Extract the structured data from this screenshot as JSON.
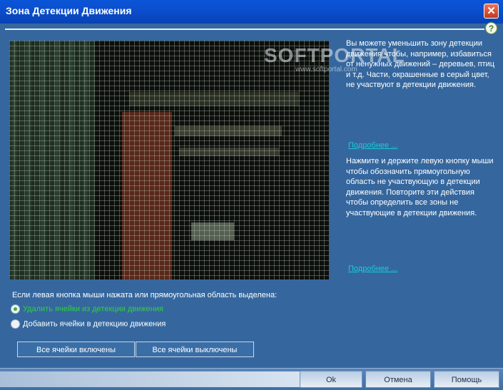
{
  "window": {
    "title": "Зона Детекции Движения",
    "close_glyph": "✕",
    "help_glyph": "?"
  },
  "watermark": {
    "brand": "SOFTPORTAL",
    "url": "www.softportal.com"
  },
  "info": {
    "paragraph1": "Вы можете уменьшить зону детекции движения чтобы, например, избавиться от ненужных движений – деревьев, птиц и т.д. Части, окрашенные в серый цвет, не участвуют в детекции движения.",
    "link1": "Подробнее ...",
    "paragraph2": "Нажмите и держите левую кнопку мыши чтобы обозначить прямоугольную область не участвующую в детекции движения. Повторите эти действия чтобы определить все зоны не участвующие в детекции движения.",
    "link2": "Подробнее ..."
  },
  "mode": {
    "label": "Если левая кнопка мыши нажата или прямоугольная область выделена:",
    "options": [
      {
        "label": "Удалить ячейки из детекции движения",
        "selected": true,
        "color": "#2fd23c"
      },
      {
        "label": "Добавить ячейки в детекцию движения",
        "selected": false,
        "color": "#ffffff"
      }
    ]
  },
  "buttons": {
    "all_on": "Все ячейки включены",
    "all_off": "Все ячейки выключены"
  },
  "footer": {
    "ok": "Ok",
    "cancel": "Отмена",
    "help": "Помощь"
  }
}
